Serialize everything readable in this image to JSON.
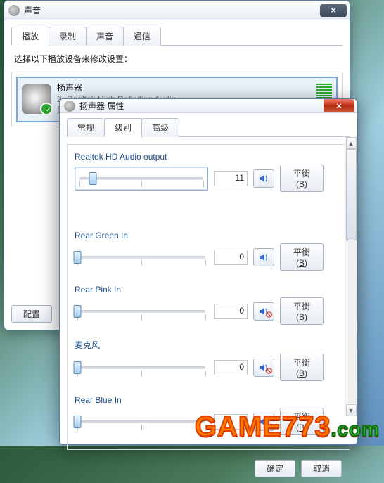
{
  "back": {
    "title": "声音",
    "tabs": [
      "播放",
      "录制",
      "声音",
      "通信"
    ],
    "active_tab": 0,
    "instruction": "选择以下播放设备来修改设置：",
    "device": {
      "name": "扬声器",
      "subtitle": "2- Realtek High Definition Audio",
      "status": "默认设备"
    },
    "buttons": {
      "configure": "配置"
    }
  },
  "front": {
    "title": "扬声器 属性",
    "tabs": [
      "常规",
      "级别",
      "高级"
    ],
    "active_tab": 1,
    "balance_label_prefix": "平衡(",
    "balance_label_hotkey": "B",
    "balance_label_suffix": ")",
    "sections": [
      {
        "label": "Realtek HD Audio output",
        "value": "11",
        "slider_pct": 11,
        "muted": false,
        "master": true
      },
      {
        "label": "Rear Green In",
        "value": "0",
        "slider_pct": 0,
        "muted": false,
        "master": false
      },
      {
        "label": "Rear Pink In",
        "value": "0",
        "slider_pct": 0,
        "muted": true,
        "master": false
      },
      {
        "label": "麦克风",
        "value": "0",
        "slider_pct": 0,
        "muted": true,
        "master": false
      },
      {
        "label": "Rear Blue In",
        "value": "0",
        "slider_pct": 0,
        "muted": false,
        "master": false
      }
    ],
    "buttons": {
      "ok": "确定",
      "cancel": "取消"
    }
  },
  "watermark": {
    "text": "GAME773",
    "ext": ".com"
  }
}
